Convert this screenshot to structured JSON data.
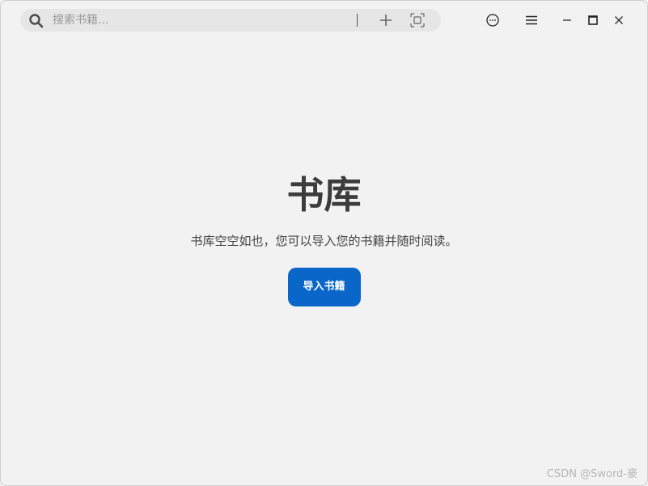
{
  "search": {
    "placeholder": "搜索书籍...",
    "value": ""
  },
  "toolbar": {
    "icons": [
      "search-icon",
      "plus-icon",
      "scan-icon",
      "more-options-icon",
      "hamburger-menu-icon",
      "minimize-icon",
      "maximize-icon",
      "close-icon"
    ]
  },
  "library": {
    "title": "书库",
    "description": "书库空空如也，您可以导入您的书籍并随时阅读。",
    "import_label": "导入书籍"
  },
  "colors": {
    "accent": "#0a66c8",
    "background": "#f2f2f2",
    "search_bg": "#e6e6e6",
    "title_text": "#3c3c3c"
  },
  "watermark": "CSDN @Sword-豪"
}
